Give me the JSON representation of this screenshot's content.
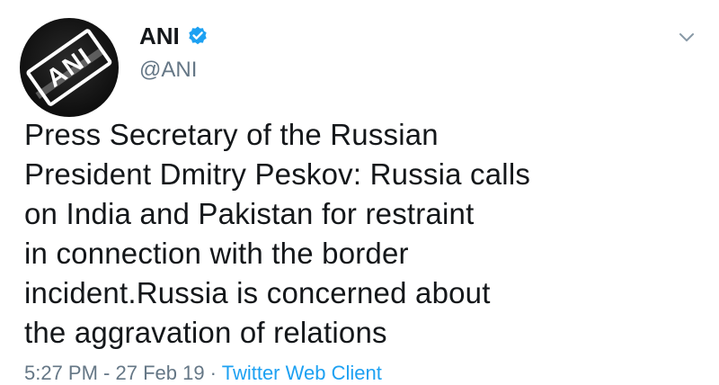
{
  "tweet": {
    "author": {
      "display_name": "ANI",
      "handle": "@ANI",
      "avatar_text": "ANI"
    },
    "text_lines": [
      "Press Secretary of the Russian",
      "President Dmitry Peskov: Russia calls",
      "on India and Pakistan for restraint",
      "in connection with the border",
      "incident.Russia is concerned about",
      "the aggravation of relations"
    ],
    "timestamp": "5:27 PM - 27 Feb 19 · ",
    "client": "Twitter Web Client",
    "icons": {
      "verified": "verified-badge-icon",
      "menu": "chevron-down-icon"
    },
    "colors": {
      "verified": "#1da1f2",
      "handle": "#657786",
      "text": "#14171a"
    }
  }
}
